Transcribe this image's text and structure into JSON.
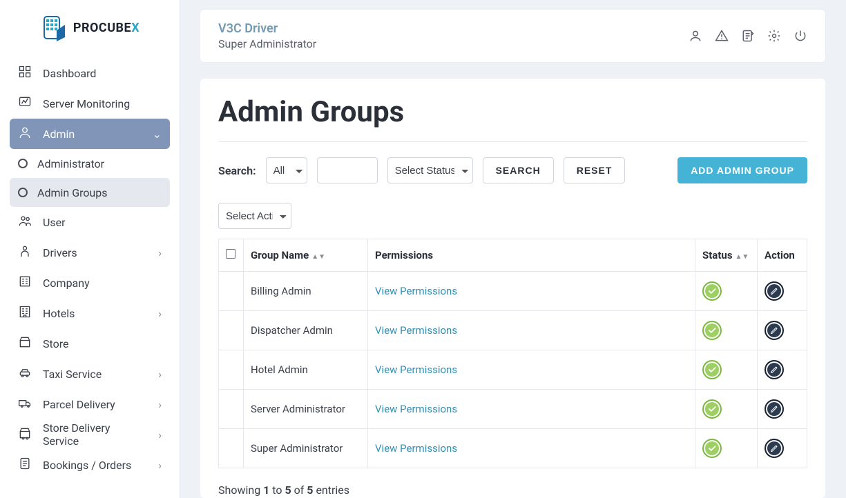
{
  "brand": {
    "name_prefix": "PROCUBE",
    "name_suffix": "X"
  },
  "header": {
    "user_name": "V3C Driver",
    "user_role": "Super Administrator"
  },
  "sidebar": {
    "items": [
      {
        "label": "Dashboard",
        "icon": "dashboard",
        "expandable": false
      },
      {
        "label": "Server Monitoring",
        "icon": "monitor",
        "expandable": false
      },
      {
        "label": "Admin",
        "icon": "admin",
        "expandable": true,
        "active": true,
        "children": [
          {
            "label": "Administrator"
          },
          {
            "label": "Admin Groups",
            "active": true
          }
        ]
      },
      {
        "label": "User",
        "icon": "users",
        "expandable": false
      },
      {
        "label": "Drivers",
        "icon": "driver",
        "expandable": true
      },
      {
        "label": "Company",
        "icon": "company",
        "expandable": false
      },
      {
        "label": "Hotels",
        "icon": "hotel",
        "expandable": true
      },
      {
        "label": "Store",
        "icon": "store",
        "expandable": false
      },
      {
        "label": "Taxi Service",
        "icon": "taxi",
        "expandable": true
      },
      {
        "label": "Parcel Delivery",
        "icon": "parcel",
        "expandable": true
      },
      {
        "label": "Store Delivery Service",
        "icon": "storedel",
        "expandable": true
      },
      {
        "label": "Bookings / Orders",
        "icon": "orders",
        "expandable": true
      }
    ]
  },
  "page": {
    "title": "Admin Groups",
    "search_label": "Search:",
    "filter_select_all": "All",
    "filter_status": "Select Status",
    "btn_search": "SEARCH",
    "btn_reset": "RESET",
    "btn_add": "ADD ADMIN GROUP",
    "action_select": "Select Action",
    "columns": {
      "group_name": "Group Name",
      "permissions": "Permissions",
      "status": "Status",
      "action": "Action"
    },
    "view_permissions_label": "View Permissions",
    "rows": [
      {
        "group_name": "Billing Admin",
        "status": "active"
      },
      {
        "group_name": "Dispatcher Admin",
        "status": "active"
      },
      {
        "group_name": "Hotel Admin",
        "status": "active"
      },
      {
        "group_name": "Server Administrator",
        "status": "active"
      },
      {
        "group_name": "Super Administrator",
        "status": "active"
      }
    ],
    "entries": {
      "prefix": "Showing ",
      "from": "1",
      "mid1": " to ",
      "to": "5",
      "mid2": " of ",
      "total": "5",
      "suffix": " entries"
    }
  }
}
